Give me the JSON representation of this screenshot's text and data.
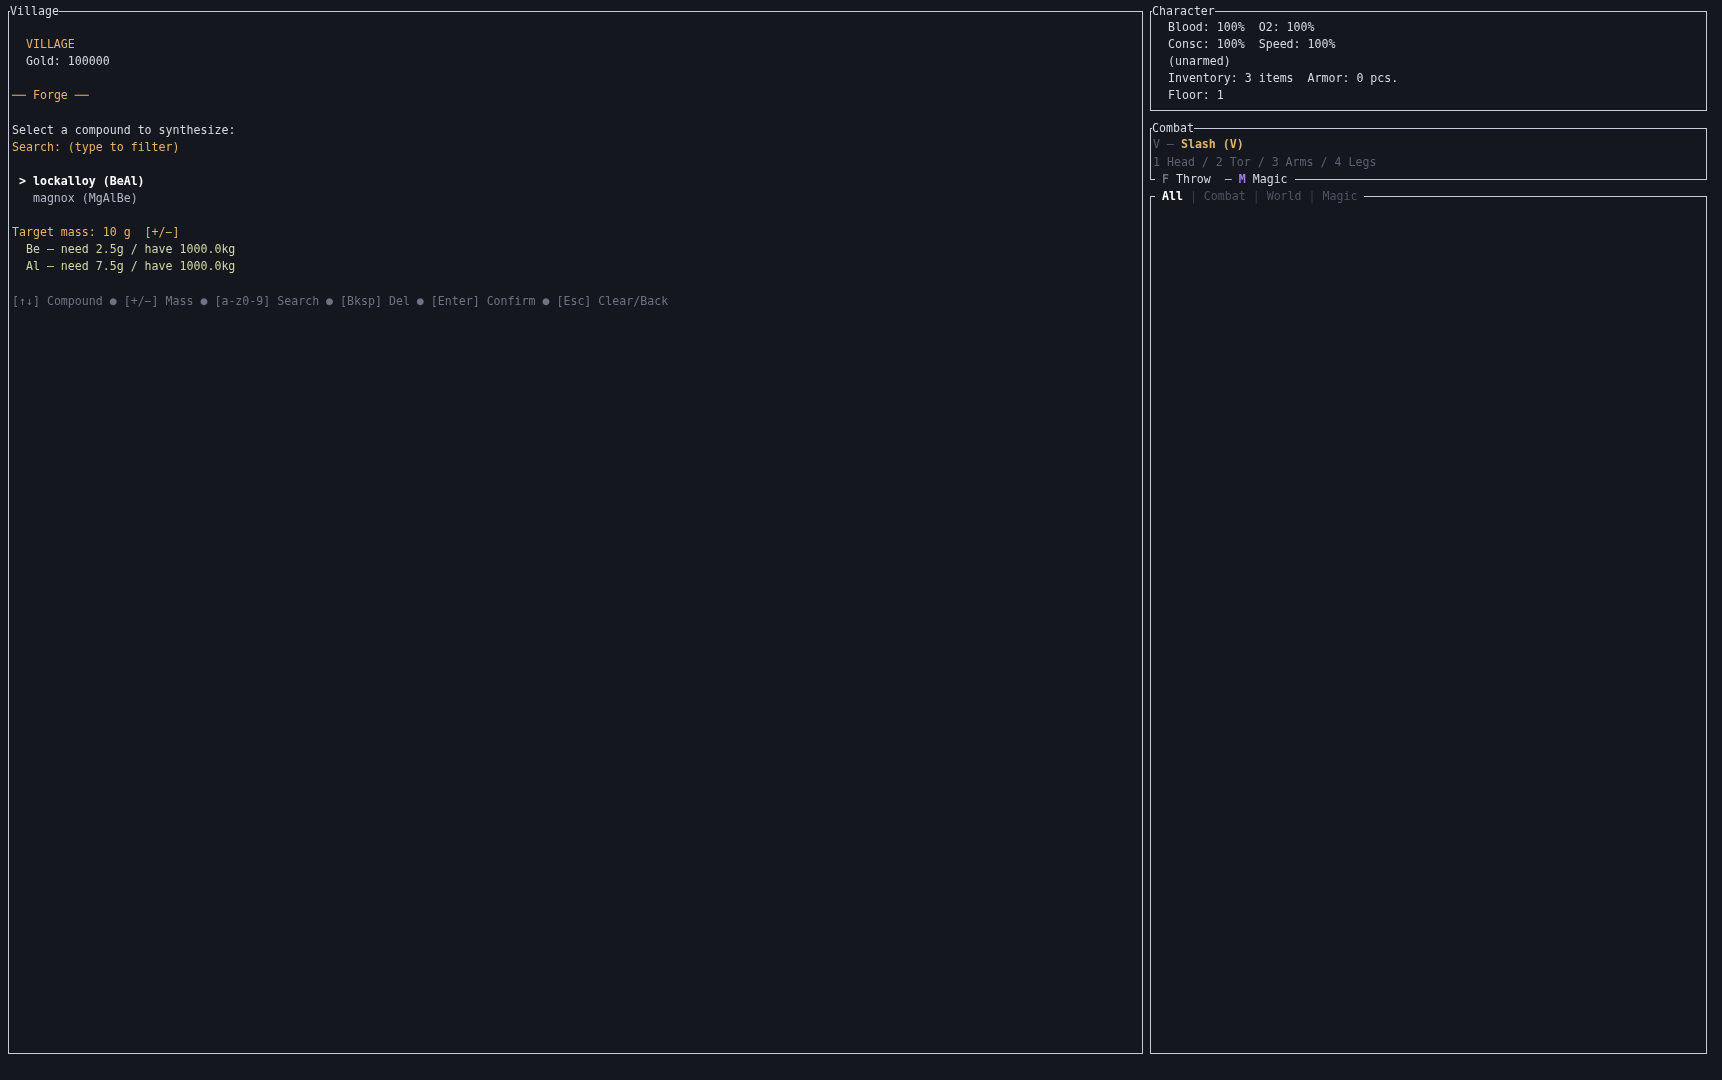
{
  "village_panel": {
    "title": "Village",
    "heading": "VILLAGE",
    "gold": "Gold: 100000",
    "section": "── Forge ──",
    "prompt": "Select a compound to synthesize:",
    "search": "Search: (type to filter)",
    "cursor": ">",
    "compounds": [
      {
        "label": "lockalloy (BeAl)",
        "selected": true
      },
      {
        "label": "magnox (MgAlBe)",
        "selected": false
      }
    ],
    "target_mass": "Target mass: 10 g  [+/−]",
    "requirements": [
      "Be – need 2.5g / have 1000.0kg",
      "Al – need 7.5g / have 1000.0kg"
    ],
    "help": "[↑↓] Compound ● [+/−] Mass ● [a-z0-9] Search ● [Bksp] Del ● [Enter] Confirm ● [Esc] Clear/Back"
  },
  "character_panel": {
    "title": "Character",
    "lines": [
      "Blood: 100%  O2: 100%",
      "Consc: 100%  Speed: 100%",
      "(unarmed)",
      "Inventory: 3 items  Armor: 0 pcs.",
      "Floor: 1"
    ]
  },
  "combat_panel": {
    "title": "Combat",
    "action_key": "V –",
    "action": "Slash (V)",
    "targets": "1 Head / 2 Tor / 3 Arms / 4 Legs",
    "footer": [
      {
        "key": "F",
        "label": "Throw",
        "color": "#6b7080"
      },
      {
        "prefix": "—",
        "key": "M",
        "label": "Magic",
        "color": "#a77bf3"
      }
    ]
  },
  "log_panel": {
    "separator": "|",
    "tabs": [
      {
        "label": "All",
        "selected": true
      },
      {
        "label": "Combat",
        "selected": false
      },
      {
        "label": "World",
        "selected": false
      },
      {
        "label": "Magic",
        "selected": false
      }
    ]
  }
}
